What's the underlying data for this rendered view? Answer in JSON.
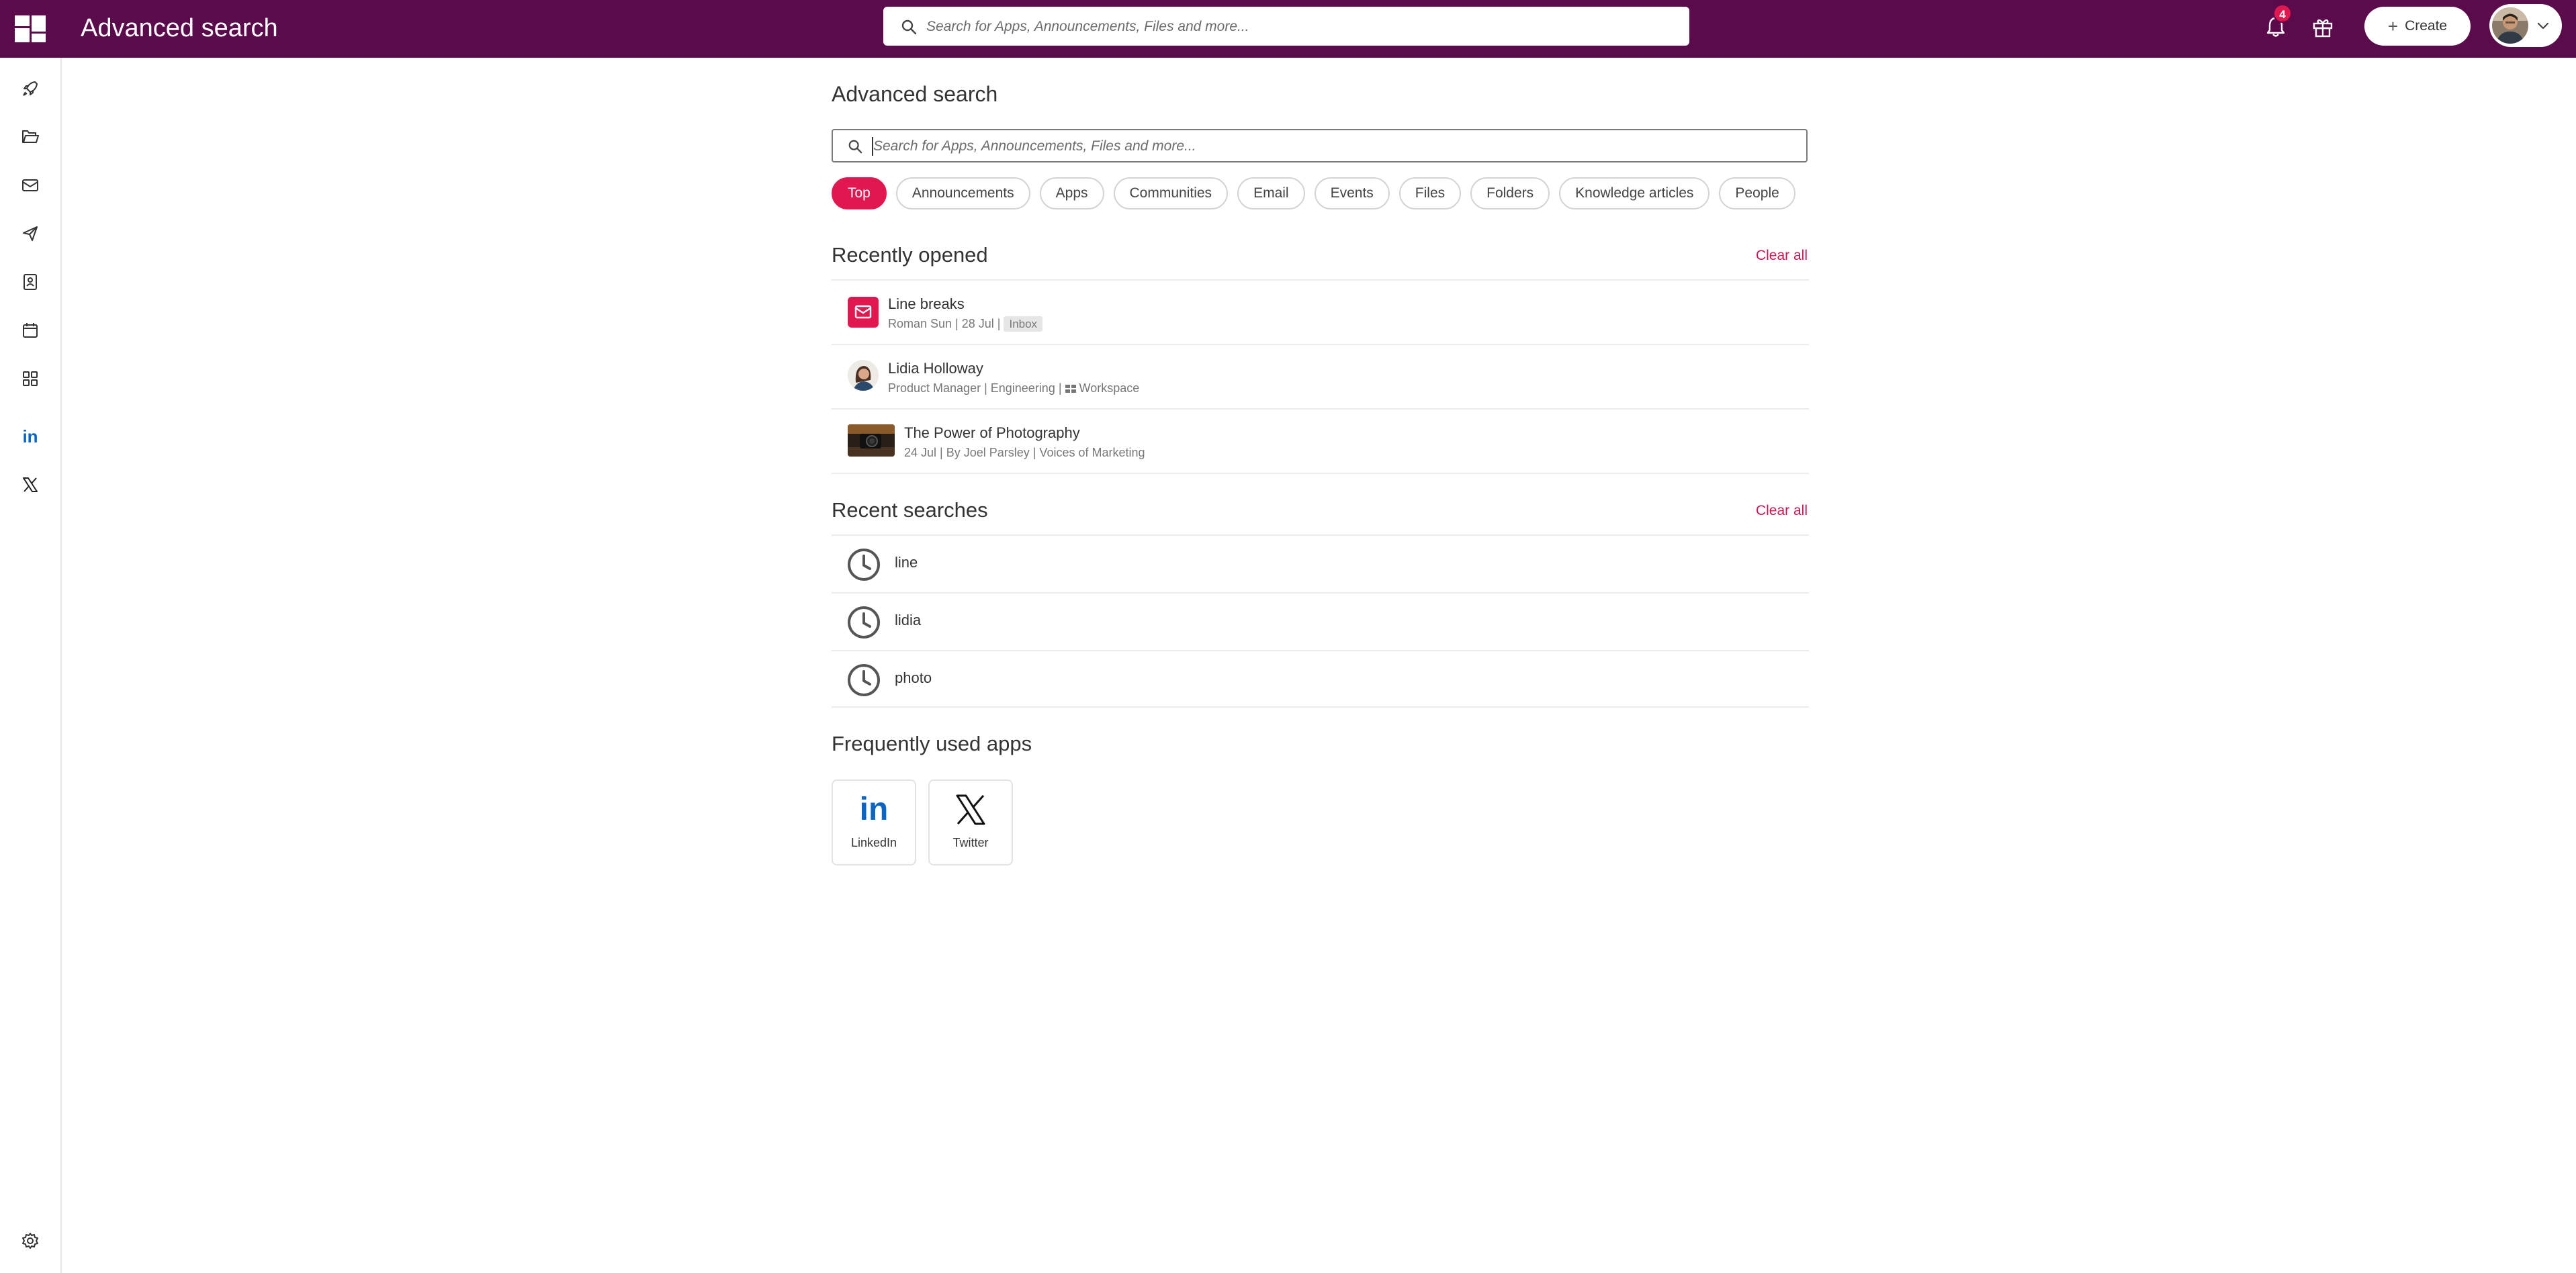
{
  "header": {
    "title": "Advanced search",
    "search_placeholder": "Search for Apps, Announcements, Files and more...",
    "notification_count": "4",
    "create_label": "Create",
    "bar_color": "#5b0a4c"
  },
  "sidebar": {
    "items": [
      {
        "name": "rocket-icon"
      },
      {
        "name": "folder-icon"
      },
      {
        "name": "mail-icon"
      },
      {
        "name": "send-icon"
      },
      {
        "name": "contact-book-icon"
      },
      {
        "name": "calendar-icon"
      },
      {
        "name": "apps-grid-icon"
      },
      {
        "name": "linkedin-icon"
      },
      {
        "name": "x-twitter-icon"
      },
      {
        "name": "settings-icon"
      }
    ]
  },
  "main": {
    "title": "Advanced search",
    "search_placeholder": "Search for Apps, Announcements, Files and more...",
    "filters": [
      "Top",
      "Announcements",
      "Apps",
      "Communities",
      "Email",
      "Events",
      "Files",
      "Folders",
      "Knowledge articles",
      "People"
    ],
    "active_filter": "Top",
    "accent_color": "#e2174f"
  },
  "recently_opened": {
    "title": "Recently opened",
    "clear_label": "Clear all",
    "items": [
      {
        "title": "Line breaks",
        "meta": "Roman Sun | 28 Jul |",
        "tag": "Inbox"
      },
      {
        "title": "Lidia Holloway",
        "meta": "Product Manager | Engineering |",
        "tag": "Workspace"
      },
      {
        "title": "The Power of Photography",
        "meta": "24 Jul | By Joel Parsley | Voices of Marketing"
      }
    ]
  },
  "recent_searches": {
    "title": "Recent searches",
    "clear_label": "Clear all",
    "items": [
      "line",
      "lidia",
      "photo"
    ]
  },
  "frequent_apps": {
    "title": "Frequently used apps",
    "items": [
      "LinkedIn",
      "Twitter"
    ]
  }
}
